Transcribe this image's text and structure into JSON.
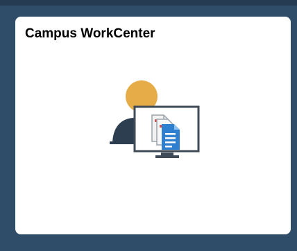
{
  "tile": {
    "title": "Campus WorkCenter",
    "icon": "person-monitor-document-icon"
  },
  "colors": {
    "page_background": "#2f4c68",
    "tile_background": "#ffffff",
    "person_head": "#e5ac47",
    "person_body": "#2c3e50",
    "monitor_frame": "#3f4b57",
    "document_blue": "#2f7fd1",
    "document_paper": "#f2f2f2",
    "document_accent": "#d9534f"
  }
}
